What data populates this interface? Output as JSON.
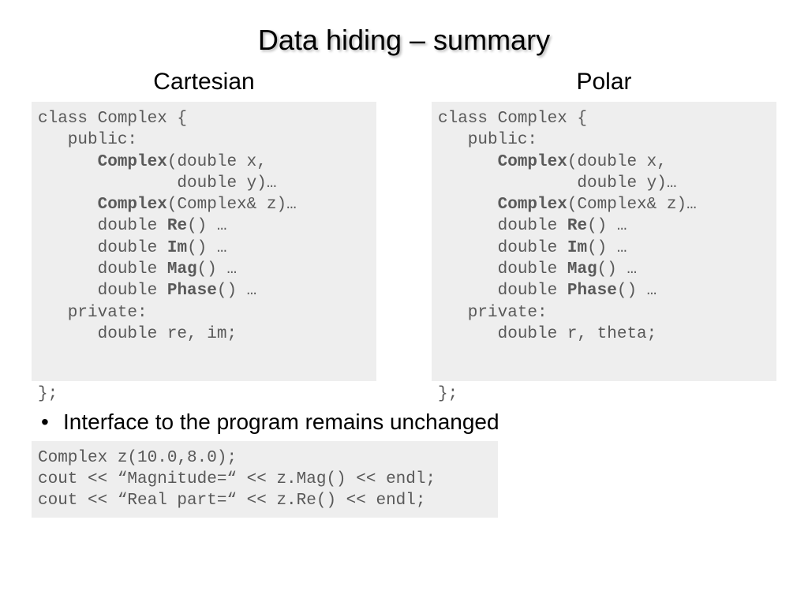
{
  "title": "Data hiding – summary",
  "left": {
    "heading": "Cartesian",
    "line1": "class Complex {",
    "line2": "   public:",
    "ctor1_a": "Complex",
    "ctor1_b": "(double x,",
    "ctor1_c": "              double y)…",
    "ctor2_a": "Complex",
    "ctor2_b": "(Complex& z)…",
    "re_a": "double ",
    "re_b": "Re",
    "re_c": "() …",
    "im_a": "double ",
    "im_b": "Im",
    "im_c": "() …",
    "mag_a": "double ",
    "mag_b": "Mag",
    "mag_c": "() …",
    "ph_a": "double ",
    "ph_b": "Phase",
    "ph_c": "() …",
    "priv": "   private:",
    "members": "      double re, im;",
    "blank": " ",
    "close": "};"
  },
  "right": {
    "heading": "Polar",
    "line1": "class Complex {",
    "line2": "   public:",
    "ctor1_a": "Complex",
    "ctor1_b": "(double x,",
    "ctor1_c": "              double y)…",
    "ctor2_a": "Complex",
    "ctor2_b": "(Complex& z)…",
    "re_a": "double ",
    "re_b": "Re",
    "re_c": "() …",
    "im_a": "double ",
    "im_b": "Im",
    "im_c": "() …",
    "mag_a": "double ",
    "mag_b": "Mag",
    "mag_c": "() …",
    "ph_a": "double ",
    "ph_b": "Phase",
    "ph_c": "() …",
    "priv": "   private:",
    "members": "      double r, theta;",
    "blank": " ",
    "close": "};"
  },
  "bullet1": "Interface to the program remains unchanged",
  "usage": {
    "l1": "Complex z(10.0,8.0);",
    "l2": "cout << “Magnitude=“ << z.Mag() << endl;",
    "l3": "cout << “Real part=“ << z.Re() << endl;"
  }
}
